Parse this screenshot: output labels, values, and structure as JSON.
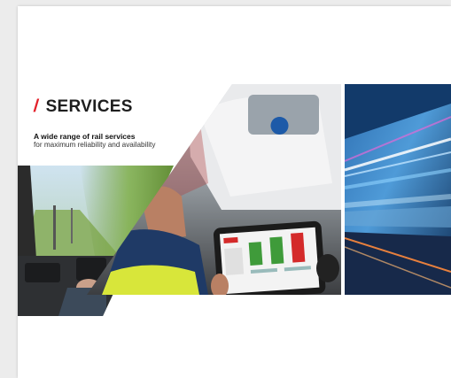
{
  "brochure": {
    "slash": "/",
    "title": "SERVICES",
    "subtitle_bold": "A wide range of rail services",
    "subtitle": "for maximum reliability and availability"
  },
  "colors": {
    "accent": "#e3202a",
    "title": "#1e1e1e",
    "tablet_green": "#3f9b3a",
    "tablet_red": "#d42a2a",
    "vest": "#d8e63a"
  },
  "images": [
    {
      "name": "tram-driver-cab-photo"
    },
    {
      "name": "technician-tablet-photo"
    },
    {
      "name": "light-trail-train-photo"
    }
  ]
}
